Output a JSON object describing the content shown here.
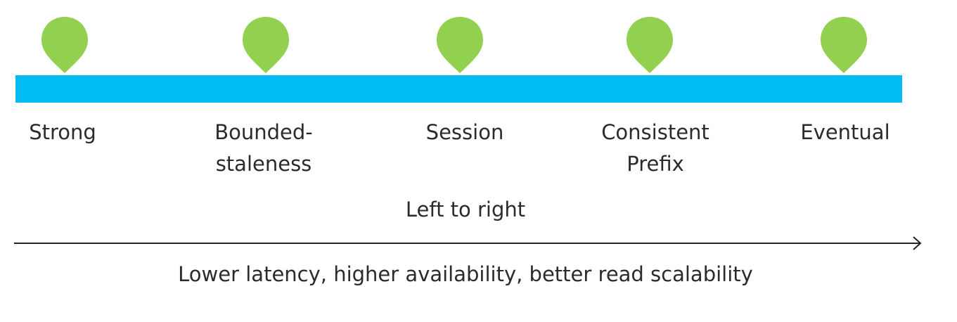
{
  "colors": {
    "bar": "#00bcf2",
    "pin": "#92d050",
    "arrow": "#222222"
  },
  "levels": [
    {
      "label": "Strong",
      "icon": "location-pin-icon"
    },
    {
      "label": "Bounded-\nstaleness",
      "icon": "location-pin-icon"
    },
    {
      "label": "Session",
      "icon": "location-pin-icon"
    },
    {
      "label": "Consistent\nPrefix",
      "icon": "location-pin-icon"
    },
    {
      "label": "Eventual",
      "icon": "location-pin-icon"
    }
  ],
  "direction_label": "Left to right",
  "benefits_label": "Lower latency, higher availability, better read scalability"
}
